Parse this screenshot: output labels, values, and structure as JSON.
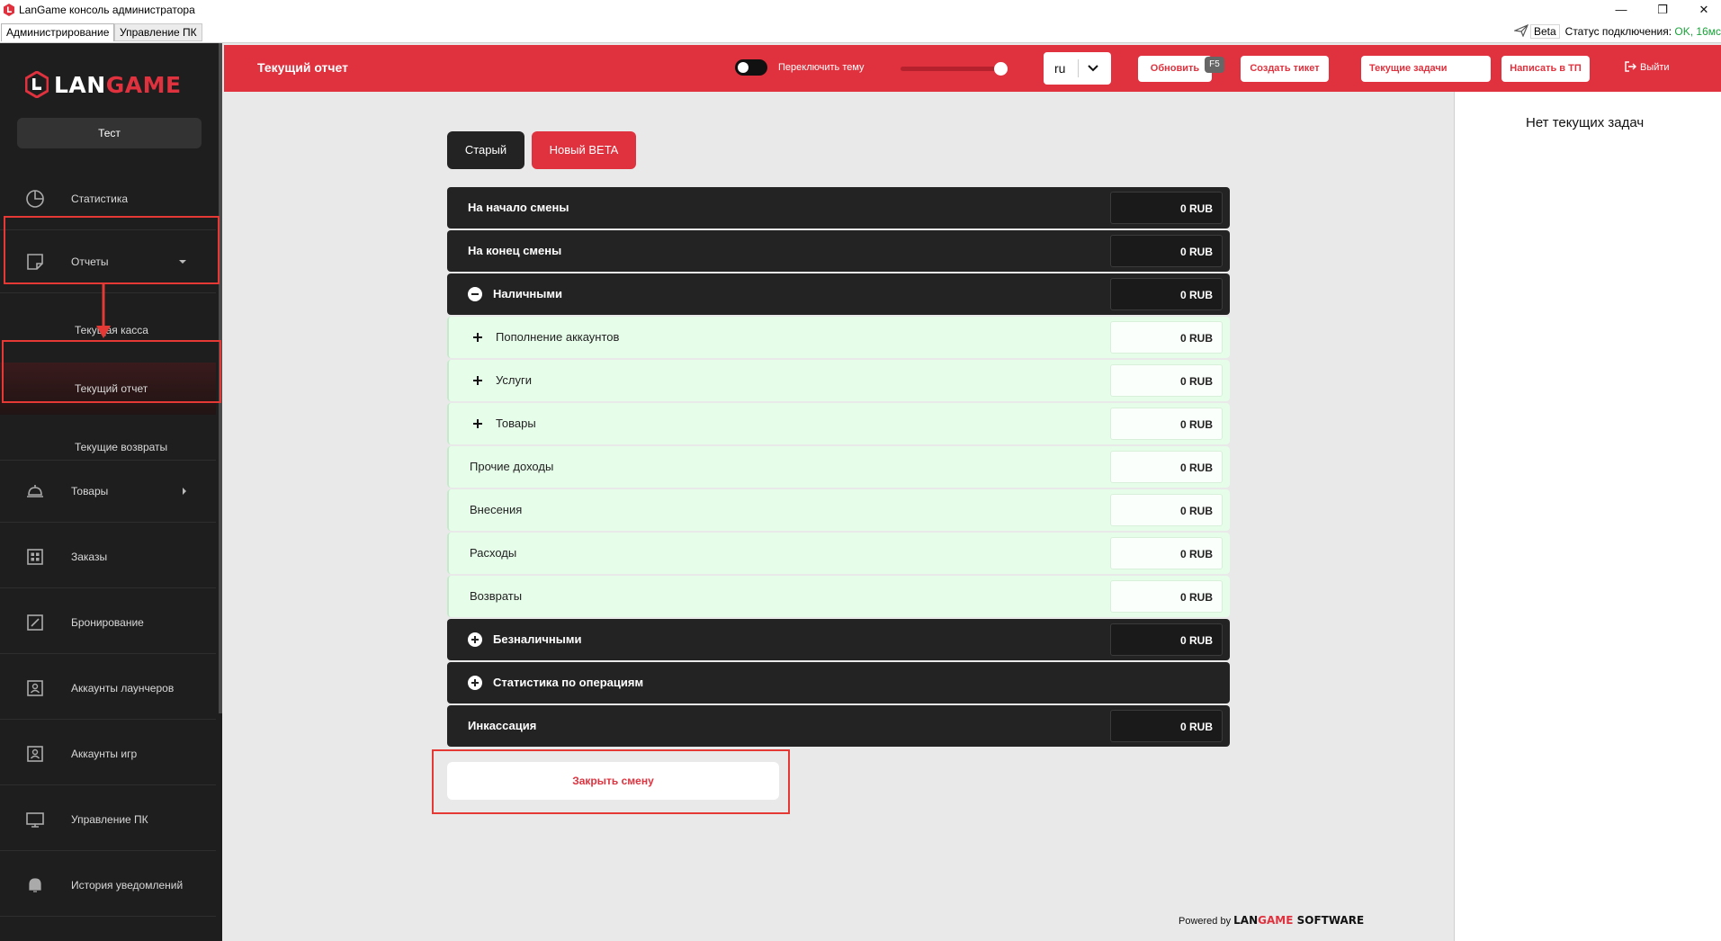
{
  "window": {
    "title": "LanGame консоль администратора",
    "minimize": "—",
    "restore": "❐",
    "close": "✕"
  },
  "menubar": {
    "tabs": [
      {
        "label": "Администрирование"
      },
      {
        "label": "Управление ПК"
      }
    ],
    "beta": "Beta",
    "connection_label": "Статус подключения:",
    "connection_value": "OK, 16мс"
  },
  "sidebar": {
    "logo": {
      "part1": "LAN",
      "part2": "GAME"
    },
    "club": "Тест",
    "items": [
      {
        "label": "Статистика",
        "icon": "pie-chart-icon"
      },
      {
        "label": "Отчеты",
        "icon": "note-icon"
      },
      {
        "label": "Товары",
        "icon": "cloche-icon"
      },
      {
        "label": "Заказы",
        "icon": "grid-icon"
      },
      {
        "label": "Бронирование",
        "icon": "edit-square-icon"
      },
      {
        "label": "Аккаунты лаунчеров",
        "icon": "account-icon"
      },
      {
        "label": "Аккаунты игр",
        "icon": "account-icon"
      },
      {
        "label": "Управление ПК",
        "icon": "monitor-icon"
      },
      {
        "label": "История уведомлений",
        "icon": "bell-icon"
      }
    ],
    "subitems": [
      {
        "label": "Текущая касса"
      },
      {
        "label": "Текущий отчет"
      },
      {
        "label": "Текущие возвраты"
      }
    ]
  },
  "header": {
    "title": "Текущий отчет",
    "theme_label": "Переключить тему",
    "lang": "ru",
    "refresh": "Обновить",
    "refresh_key": "F5",
    "create_ticket": "Создать тикет",
    "current_tasks": "Текущие задачи",
    "write_support": "Написать в ТП",
    "logout": "Выйти"
  },
  "main": {
    "tab_old": "Старый",
    "tab_new": "Новый BETA",
    "rows": [
      {
        "label": "На начало смены",
        "value": "0 RUB"
      },
      {
        "label": "На конец смены",
        "value": "0 RUB"
      },
      {
        "label": "Наличными",
        "value": "0 RUB"
      },
      {
        "label": "Пополнение аккаунтов",
        "value": "0 RUB"
      },
      {
        "label": "Услуги",
        "value": "0 RUB"
      },
      {
        "label": "Товары",
        "value": "0 RUB"
      },
      {
        "label": "Прочие доходы",
        "value": "0 RUB"
      },
      {
        "label": "Внесения",
        "value": "0 RUB"
      },
      {
        "label": "Расходы",
        "value": "0 RUB"
      },
      {
        "label": "Возвраты",
        "value": "0 RUB"
      },
      {
        "label": "Безналичными",
        "value": "0 RUB"
      },
      {
        "label": "Статистика по операциям"
      },
      {
        "label": "Инкассация",
        "value": "0 RUB"
      }
    ],
    "close_shift": "Закрыть смену",
    "powered_by": "Powered by",
    "powered_brand": {
      "part1": "LAN",
      "part2": "GAME",
      "part3": " SOFTWARE"
    }
  },
  "right_panel": {
    "message": "Нет текущих задач"
  },
  "colors": {
    "accent": "#e0323e",
    "sidebar": "#1e1e1e",
    "row_dark": "#232323",
    "row_light": "#e6fde9",
    "annotation": "#e53935"
  }
}
